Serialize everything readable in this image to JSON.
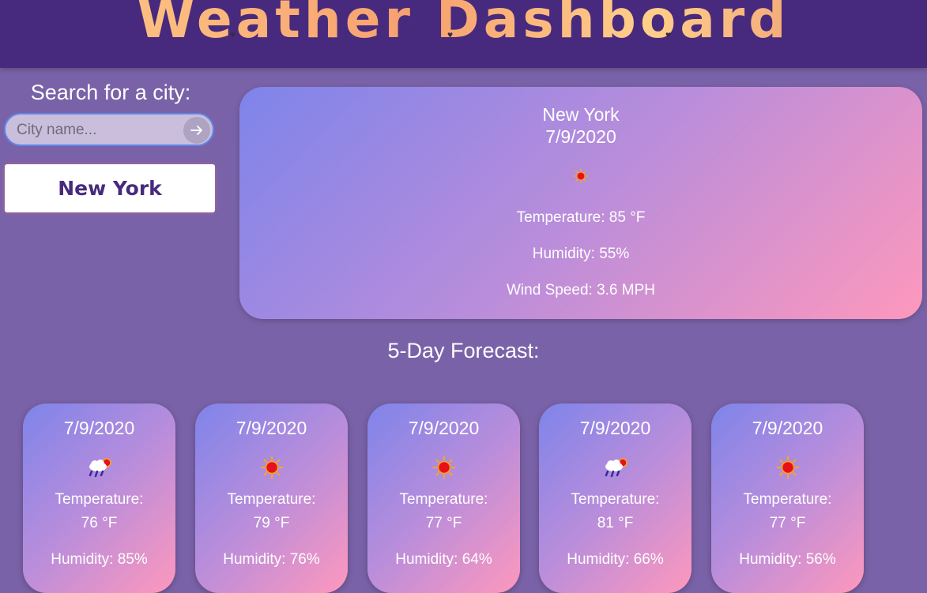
{
  "header": {
    "title": "Weather Dashboard"
  },
  "search": {
    "label": "Search for a city:",
    "placeholder": "City name...",
    "history": [
      "New York"
    ]
  },
  "current": {
    "city": "New York",
    "date": "7/9/2020",
    "icon": "sun-icon",
    "temperature": "Temperature: 85 °F",
    "humidity": "Humidity: 55%",
    "wind": "Wind Speed: 3.6 MPH"
  },
  "forecast": {
    "heading": "5-Day Forecast:",
    "temp_label": "Temperature:",
    "days": [
      {
        "date": "7/9/2020",
        "icon": "rain-sun-icon",
        "temp": "76 °F",
        "humidity": "Humidity: 85%"
      },
      {
        "date": "7/9/2020",
        "icon": "sun-icon",
        "temp": "79 °F",
        "humidity": "Humidity: 76%"
      },
      {
        "date": "7/9/2020",
        "icon": "sun-icon",
        "temp": "77 °F",
        "humidity": "Humidity: 64%"
      },
      {
        "date": "7/9/2020",
        "icon": "rain-sun-icon",
        "temp": "81 °F",
        "humidity": "Humidity: 66%"
      },
      {
        "date": "7/9/2020",
        "icon": "sun-icon",
        "temp": "77 °F",
        "humidity": "Humidity: 56%"
      }
    ]
  },
  "colors": {
    "header_bg": "#472a7d",
    "page_bg": "#7a62a8",
    "card_gradient_start": "#7e84ea",
    "card_gradient_end": "#fe98bd",
    "accent_text": "#472a7d"
  }
}
